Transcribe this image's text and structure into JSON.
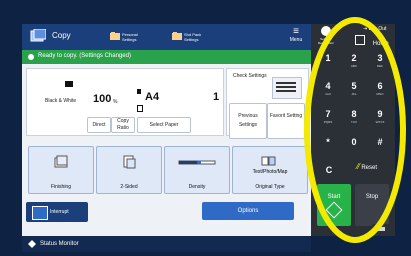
{
  "header": {
    "title": "Copy",
    "personal_settings": "Personal Settings",
    "shared_settings": "Shd Pack Settings",
    "menu": "Menu"
  },
  "status": {
    "message": "Ready to copy. (Settings Changed)"
  },
  "copy_settings": {
    "color_mode": "Black & White",
    "ratio": "100",
    "ratio_unit": "%",
    "paper": "A4",
    "copies": "1",
    "direct": "Direct",
    "copy_ratio": "Copy Ratio",
    "select_paper": "Select Paper",
    "check_settings": "Check Settings",
    "previous_settings": "Previous Settings",
    "favorite_settings": "Favorit Setting"
  },
  "functions": [
    {
      "label": "Finishing"
    },
    {
      "label": "2-Sided"
    },
    {
      "label": "Density"
    },
    {
      "label": "Original Type",
      "top_label": "Text/Photo/Map"
    }
  ],
  "bottom": {
    "interrupt": "Interrupt",
    "options": "Options",
    "status_monitor": "Status Monitor"
  },
  "keypad": {
    "settings_reg": "Settings/ Registration",
    "home": "Home",
    "logout": "Log Out",
    "keys": [
      {
        "n": "1",
        "l": ""
      },
      {
        "n": "2",
        "l": "ABC"
      },
      {
        "n": "3",
        "l": "DEF"
      },
      {
        "n": "4",
        "l": "GHI"
      },
      {
        "n": "5",
        "l": "JKL"
      },
      {
        "n": "6",
        "l": "MNO"
      },
      {
        "n": "7",
        "l": "PQRS"
      },
      {
        "n": "8",
        "l": "TUV"
      },
      {
        "n": "9",
        "l": "WXYZ"
      },
      {
        "n": "*",
        "l": ""
      },
      {
        "n": "0",
        "l": ""
      },
      {
        "n": "#",
        "l": ""
      }
    ],
    "clear": "C",
    "reset": "Reset",
    "start": "Start",
    "stop": "Stop"
  },
  "colors": {
    "highlight_ring": "#f3ea00",
    "start": "#27b34a",
    "accent": "#2f6bc6"
  }
}
